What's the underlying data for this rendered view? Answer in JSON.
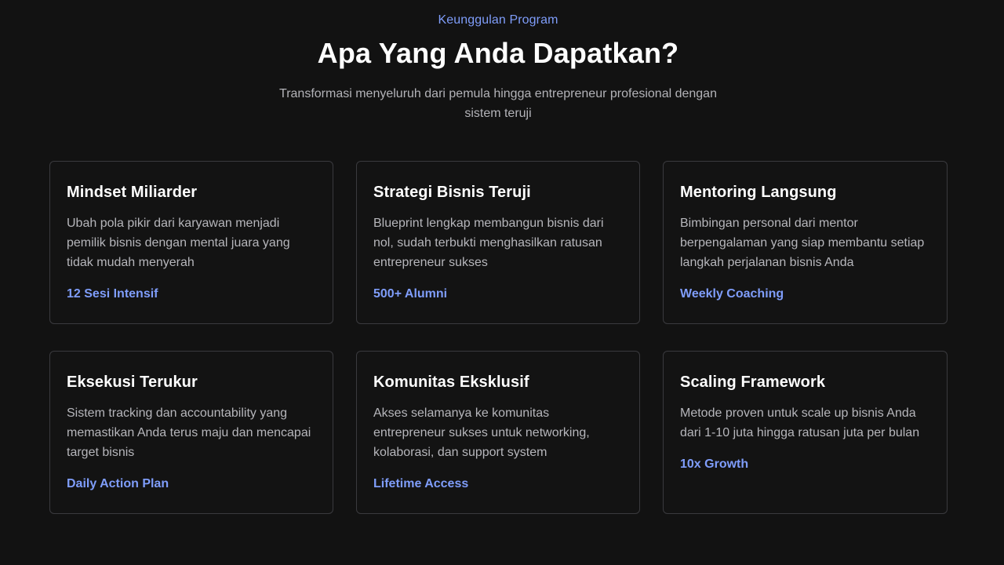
{
  "header": {
    "eyebrow": "Keunggulan Program",
    "title": "Apa Yang Anda Dapatkan?",
    "subtitle": "Transformasi menyeluruh dari pemula hingga entrepreneur profesional dengan sistem teruji"
  },
  "cards": [
    {
      "title": "Mindset Miliarder",
      "description": "Ubah pola pikir dari karyawan menjadi pemilik bisnis dengan mental juara yang tidak mudah menyerah",
      "tag": "12 Sesi Intensif"
    },
    {
      "title": "Strategi Bisnis Teruji",
      "description": "Blueprint lengkap membangun bisnis dari nol, sudah terbukti menghasilkan ratusan entrepreneur sukses",
      "tag": "500+ Alumni"
    },
    {
      "title": "Mentoring Langsung",
      "description": "Bimbingan personal dari mentor berpengalaman yang siap membantu setiap langkah perjalanan bisnis Anda",
      "tag": "Weekly Coaching"
    },
    {
      "title": "Eksekusi Terukur",
      "description": "Sistem tracking dan accountability yang memastikan Anda terus maju dan mencapai target bisnis",
      "tag": "Daily Action Plan"
    },
    {
      "title": "Komunitas Eksklusif",
      "description": "Akses selamanya ke komunitas entrepreneur sukses untuk networking, kolaborasi, dan support system",
      "tag": "Lifetime Access"
    },
    {
      "title": "Scaling Framework",
      "description": "Metode proven untuk scale up bisnis Anda dari 1-10 juta hingga ratusan juta per bulan",
      "tag": "10x Growth"
    }
  ],
  "colors": {
    "background": "#121212",
    "accent": "#7f9dfa",
    "card_border": "#3a3a3e",
    "heading": "#ffffff",
    "body_text": "#b6b6bb"
  }
}
